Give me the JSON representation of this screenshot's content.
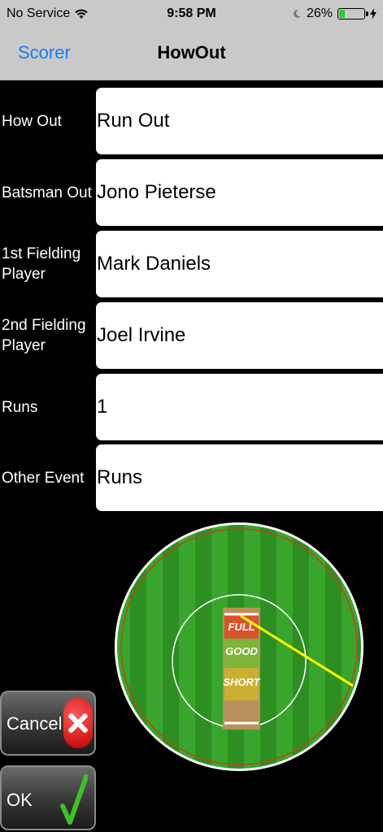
{
  "status_bar": {
    "carrier": "No Service",
    "time": "9:58 PM",
    "battery_percent": "26%",
    "battery_level": 0.26
  },
  "nav": {
    "back_label": "Scorer",
    "title": "HowOut"
  },
  "form": [
    {
      "label": "How Out",
      "value": "Run Out"
    },
    {
      "label": "Batsman Out",
      "value": "Jono Pieterse"
    },
    {
      "label": "1st Fielding Player",
      "value": "Mark Daniels"
    },
    {
      "label": "2nd Fielding Player",
      "value": "Joel Irvine"
    },
    {
      "label": "Runs",
      "value": "1"
    },
    {
      "label": "Other Event",
      "value": "Runs"
    }
  ],
  "pitch_zones": {
    "full": "FULL",
    "good": "GOOD",
    "short": "SHORT"
  },
  "buttons": {
    "cancel": "Cancel",
    "ok": "OK"
  },
  "colors": {
    "accent": "#1a7cf0",
    "grass_light": "#3aa52c",
    "grass_dark": "#2d8f22",
    "full_zone": "#d9542c",
    "good_zone": "#7fb53a",
    "short_zone": "#c9b032",
    "shot_line": "#ffff00"
  }
}
